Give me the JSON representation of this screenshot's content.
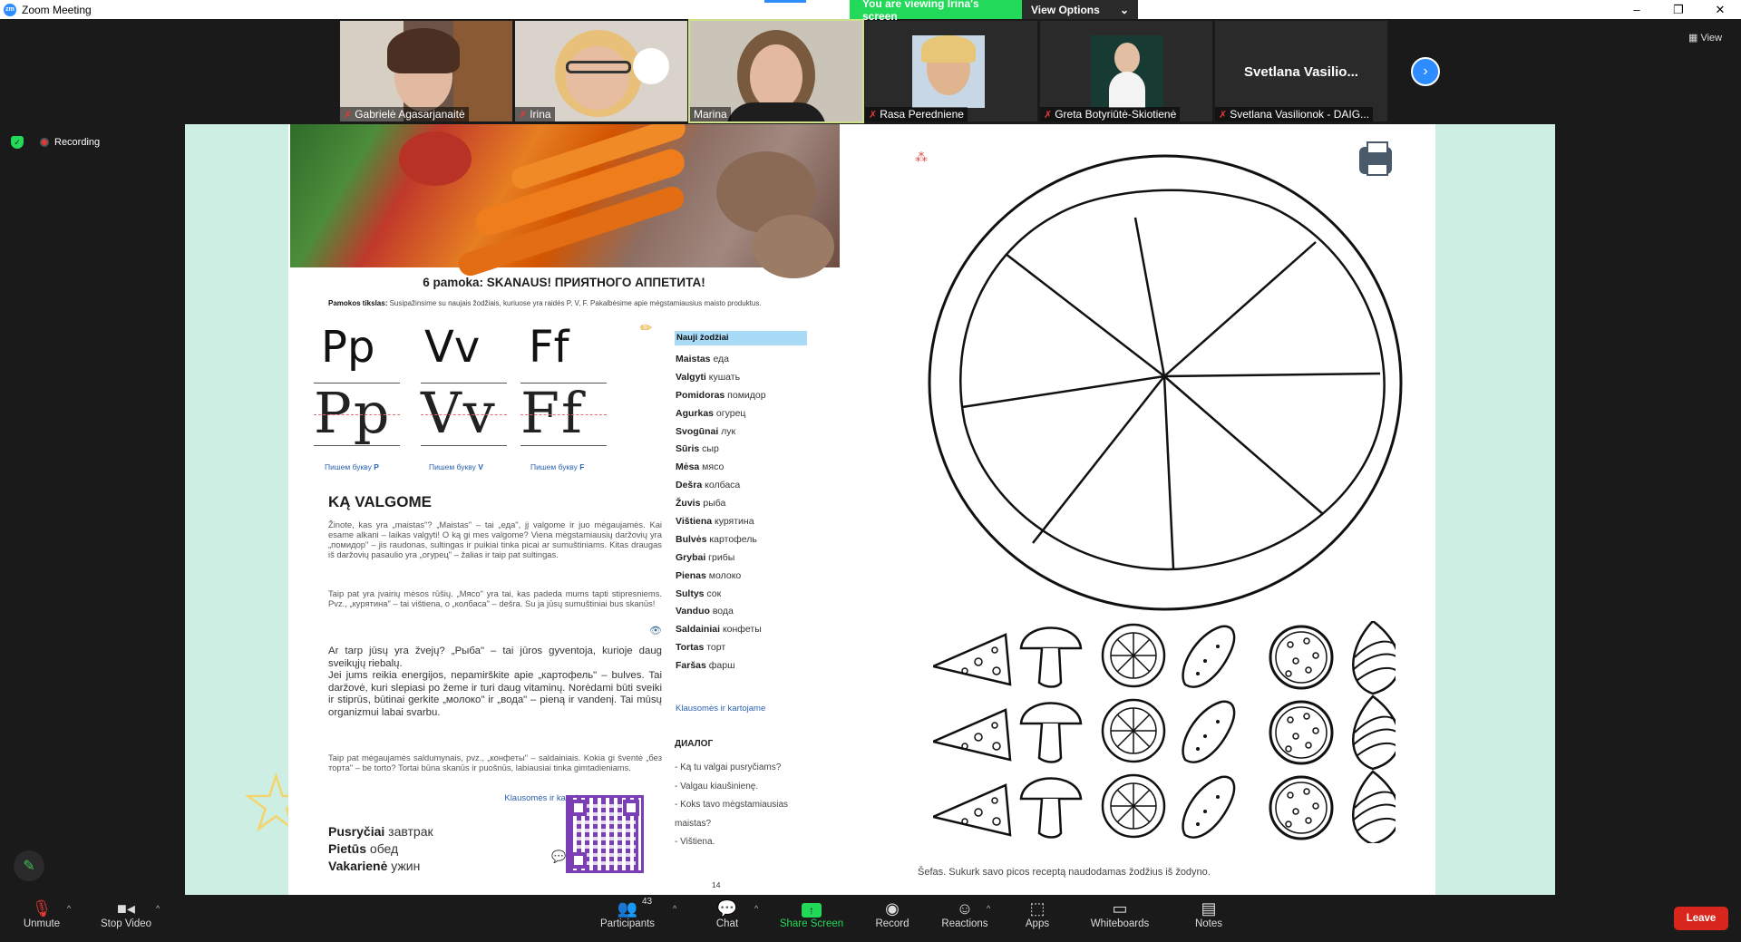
{
  "window": {
    "title": "Zoom Meeting",
    "controls": [
      "–",
      "❐",
      "✕"
    ]
  },
  "banner": {
    "viewing": "You are viewing Irina's screen",
    "options": "View Options",
    "options_caret": "⌄"
  },
  "gallery": {
    "participants": [
      {
        "name": "Gabrielė Agasarjanaitė",
        "muted": true
      },
      {
        "name": "Irina",
        "muted": true
      },
      {
        "name": "Marina",
        "muted": false
      },
      {
        "name": "Rasa Peredniene",
        "muted": true
      },
      {
        "name": "Greta Botyriūtė-Skiotienė",
        "muted": true
      },
      {
        "name": "Svetlana Vasilionok - DAIG...",
        "muted": true,
        "big_label": "Svetlana  Vasilio..."
      }
    ],
    "next": "›",
    "view_label": "View"
  },
  "status": {
    "recording": "Recording"
  },
  "lesson": {
    "title": "6 pamoka: SKANAUS! ПРИЯТНОГО АППЕТИТА!",
    "goal_label": "Pamokos tikslas:",
    "goal_text": " Susipažinsime su naujais žodžiais, kuriuose yra raidės P, V, F. Pakalbėsime apie mėgstamiausius maisto produktus.",
    "letters": [
      {
        "big": "Pp",
        "trace": "Pp",
        "caption": "Пишем букву ",
        "cap_letter": "P"
      },
      {
        "big": "Vv",
        "trace": "Vv",
        "caption": "Пишем букву ",
        "cap_letter": "V"
      },
      {
        "big": "Ff",
        "trace": "Ff",
        "caption": "Пишем букву ",
        "cap_letter": "F"
      }
    ],
    "new_words_header": "Nauji žodžiai",
    "vocab": [
      {
        "lt": "Maistas",
        "ru": " еда"
      },
      {
        "lt": "Valgyti",
        "ru": " кушать"
      },
      {
        "lt": "Pomidoras",
        "ru": " помидор"
      },
      {
        "lt": "Agurkas",
        "ru": " огурец"
      },
      {
        "lt": "Svogūnai",
        "ru": " лук"
      },
      {
        "lt": "Sūris",
        "ru": " сыр"
      },
      {
        "lt": "Mėsa",
        "ru": " мясо"
      },
      {
        "lt": "Dešra",
        "ru": " колбаса"
      },
      {
        "lt": "Žuvis",
        "ru": " рыба"
      },
      {
        "lt": "Vištiena",
        "ru": " курятина"
      },
      {
        "lt": "Bulvės",
        "ru": " картофель"
      },
      {
        "lt": "Grybai",
        "ru": " грибы"
      },
      {
        "lt": "Pienas",
        "ru": " молоко"
      },
      {
        "lt": "Sultys",
        "ru": " сок"
      },
      {
        "lt": "Vanduo",
        "ru": " вода"
      },
      {
        "lt": "Saldainiai",
        "ru": " конфеты"
      },
      {
        "lt": "Tortas",
        "ru": " торт"
      },
      {
        "lt": "Faršas",
        "ru": " фарш"
      }
    ],
    "vocab_audio": "Klausomės ir kartojame",
    "dialog_header": "ДИАЛОГ",
    "dialog": [
      "- Ką tu valgai pusryčiams?",
      "- Valgau kiaušinienę.",
      "- Koks tavo mėgstamiausias maistas?",
      "- Vištiena."
    ],
    "section_title": "KĄ VALGOME",
    "paragraphs": [
      "Žinote, kas yra „maistas\"? „Maistas\" – tai „еда\", jį valgome ir juo mėgaujamės. Kai esame alkani – laikas valgyti! O ką gi mes valgome? Viena mėgstamiausių daržovių yra „помидор\" – jis raudonas, sultingas ir puikiai tinka picai ar sumuštiniams. Kitas draugas iš daržovių pasaulio yra „огурец\" – žalias ir taip pat sultingas.",
      "Taip pat yra įvairių mėsos rūšių. „Мясо\" yra tai, kas padeda mums tapti stipresniems. Pvz., „курятина\" – tai vištiena, o „колбаса\" – dešra. Su ja jūsų sumuštiniai bus skanūs!",
      "Ar tarp jūsų yra žvejų? „Рыба\" – tai jūros gyventoja, kurioje daug sveikųjų riebalų.\nJei jums reikia energijos, nepamirškite apie „картофель\" – bulves. Tai daržovė, kuri slepiasi po žeme ir turi daug vitaminų. Norėdami būti sveiki ir stiprūs, būtinai gerkite „молоко\" ir „вода\" – pieną ir vandenį. Tai mūsų organizmui labai svarbu.",
      "Taip pat mėgaujamės saldumynais, pvz., „конфеты\" – saldainiais. Kokia gi šventė „без торта\" – be torto? Tortai būna skanūs ir puošnūs, labiausiai tinka gimtadieniams."
    ],
    "qr_audio": "Klausomės ir kartojame",
    "meals": [
      {
        "lt": "Pusryčiai",
        "ru": " завтрак"
      },
      {
        "lt": "Pietūs",
        "ru": " обед"
      },
      {
        "lt": "Vakarienė",
        "ru": " ужин"
      }
    ],
    "page_number": "14"
  },
  "worksheet": {
    "caption": "Šefas. Sukurk savo picos receptą naudodamas žodžius iš žodyno."
  },
  "toolbar": {
    "unmute": "Unmute",
    "stop_video": "Stop Video",
    "participants": "Participants",
    "participants_count": "43",
    "chat": "Chat",
    "share_screen": "Share Screen",
    "record": "Record",
    "reactions": "Reactions",
    "apps": "Apps",
    "whiteboards": "Whiteboards",
    "notes": "Notes",
    "leave": "Leave"
  },
  "colors": {
    "accent": "#2d8cff",
    "share_green": "#23d959",
    "leave_red": "#d9261c",
    "mint_bg": "#cdeee2"
  }
}
